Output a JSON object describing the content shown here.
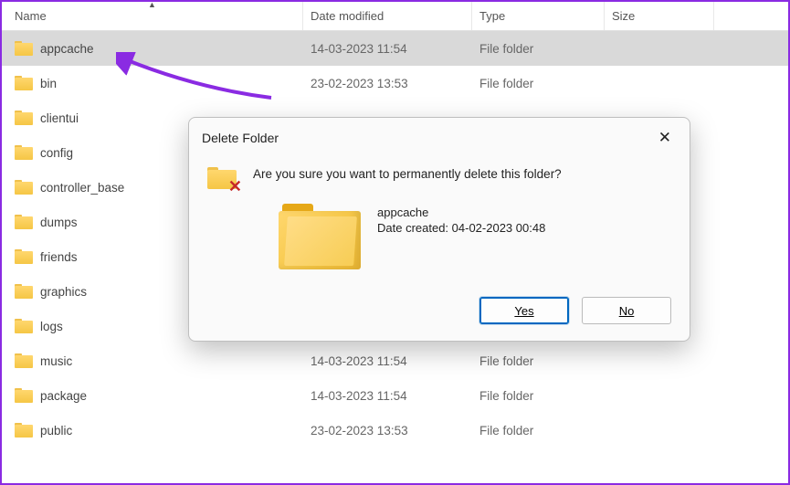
{
  "columns": {
    "name": "Name",
    "date": "Date modified",
    "type": "Type",
    "size": "Size"
  },
  "rows": [
    {
      "name": "appcache",
      "date": "14-03-2023 11:54",
      "type": "File folder",
      "selected": true
    },
    {
      "name": "bin",
      "date": "23-02-2023 13:53",
      "type": "File folder",
      "selected": false
    },
    {
      "name": "clientui",
      "date": "",
      "type": "",
      "selected": false
    },
    {
      "name": "config",
      "date": "",
      "type": "",
      "selected": false
    },
    {
      "name": "controller_base",
      "date": "",
      "type": "",
      "selected": false
    },
    {
      "name": "dumps",
      "date": "",
      "type": "",
      "selected": false
    },
    {
      "name": "friends",
      "date": "",
      "type": "",
      "selected": false
    },
    {
      "name": "graphics",
      "date": "",
      "type": "",
      "selected": false
    },
    {
      "name": "logs",
      "date": "",
      "type": "",
      "selected": false
    },
    {
      "name": "music",
      "date": "14-03-2023 11:54",
      "type": "File folder",
      "selected": false
    },
    {
      "name": "package",
      "date": "14-03-2023 11:54",
      "type": "File folder",
      "selected": false
    },
    {
      "name": "public",
      "date": "23-02-2023 13:53",
      "type": "File folder",
      "selected": false
    }
  ],
  "dialog": {
    "title": "Delete Folder",
    "message": "Are you sure you want to permanently delete this folder?",
    "folderName": "appcache",
    "dateCreated": "Date created: 04-02-2023 00:48",
    "yesLabel": "Yes",
    "noLabel": "No"
  },
  "annotation": {
    "arrowColor": "#8a2be2"
  }
}
